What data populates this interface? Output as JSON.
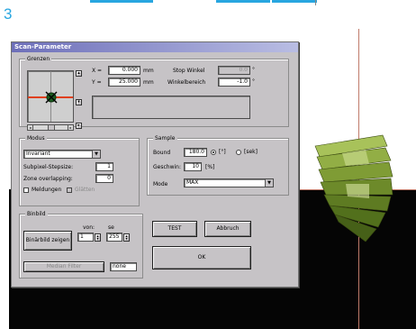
{
  "figure_number": "3",
  "window": {
    "title": "Scan-Parameter",
    "grenzen": {
      "label": "Grenzen",
      "x_label": "X =",
      "x_value": "0.000",
      "x_unit": "mm",
      "y_label": "Y =",
      "y_value": "25.000",
      "y_unit": "mm",
      "stop_winkel_label": "Stop Winkel",
      "stop_winkel_value": "0.0",
      "stop_winkel_unit": "°",
      "winkelbereich_label": "Winkelbereich",
      "winkelbereich_value": "-1.0",
      "winkelbereich_unit": "°"
    },
    "modus": {
      "label": "Modus",
      "selected": "Invariant",
      "subpixel_label": "Subpixel-Stepsize:",
      "subpixel_value": "1",
      "zone_label": "Zone overlapping:",
      "zone_value": "0",
      "meldungen_label": "Meldungen",
      "glatten_label": "Glätten"
    },
    "sample": {
      "label": "Sample",
      "bound_label": "Bound",
      "bound_value": "180.0",
      "deg_label": "[°]",
      "sek_label": "[sek]",
      "geschwin_label": "Geschwin:",
      "geschwin_value": "10",
      "geschwin_unit": "[%]",
      "mode_label": "Mode",
      "mode_value": "MAX"
    },
    "binbild": {
      "label": "Binbild",
      "von_label": "von:",
      "von_value": "1",
      "se_label": "se",
      "se_value": "255",
      "show_button": "Binärbild zeigen",
      "median_button": "Median Filter",
      "none_value": "none"
    },
    "test_button": "TEST",
    "abbruch_button": "Abbruch",
    "ok_button": "OK"
  },
  "colors": {
    "accent": "#28a6e0",
    "crosshair": "#e0401a",
    "fan": "#8aa83a"
  }
}
